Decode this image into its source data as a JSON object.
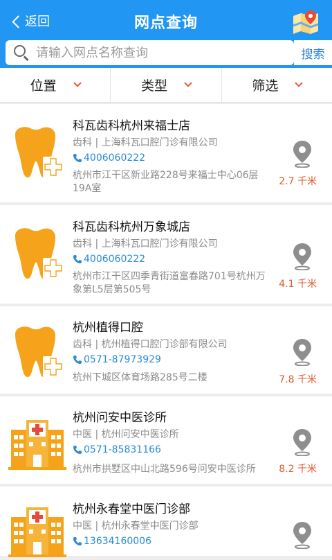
{
  "header": {
    "back_label": "返回",
    "title": "网点查询"
  },
  "search": {
    "placeholder": "请输入网点名称查询",
    "button_label": "搜索"
  },
  "filters": [
    "位置",
    "类型",
    "筛选"
  ],
  "colors": {
    "primary": "#2196f3",
    "tooth": "#f5a31a",
    "hospital": "#f5a31a",
    "distance": "#e05a2c",
    "phone": "#2a8ad8"
  },
  "items": [
    {
      "icon": "tooth-icon",
      "name": "科瓦齿科杭州来福士店",
      "category": "齿科 | 上海科瓦口腔门诊有限公司",
      "phone": "4006060222",
      "address": "杭州市江干区新业路228号来福士中心06层19A室",
      "distance": "2.7 千米"
    },
    {
      "icon": "tooth-icon",
      "name": "科瓦齿科杭州万象城店",
      "category": "齿科 | 上海科瓦口腔门诊有限公司",
      "phone": "4006060222",
      "address": "杭州市江干区四季青街道富春路701号杭州万象第L5层第505号",
      "distance": "4.1 千米"
    },
    {
      "icon": "tooth-icon",
      "name": "杭州植得口腔",
      "category": "齿科 | 杭州植得口腔门诊部有限公司",
      "phone": "0571-87973929",
      "address": "杭州下城区体育场路285号二楼",
      "distance": "7.8 千米"
    },
    {
      "icon": "hospital-icon",
      "name": "杭州问安中医诊所",
      "category": "中医 | 杭州问安中医诊所",
      "phone": "0571-85831166",
      "address": "杭州市拱墅区中山北路596号问安中医诊所",
      "distance": "8.2 千米"
    },
    {
      "icon": "hospital-icon",
      "name": "杭州永春堂中医门诊部",
      "category": "中医 | 杭州永春堂中医门诊部",
      "phone": "13634160006",
      "address": "",
      "distance": ""
    }
  ]
}
